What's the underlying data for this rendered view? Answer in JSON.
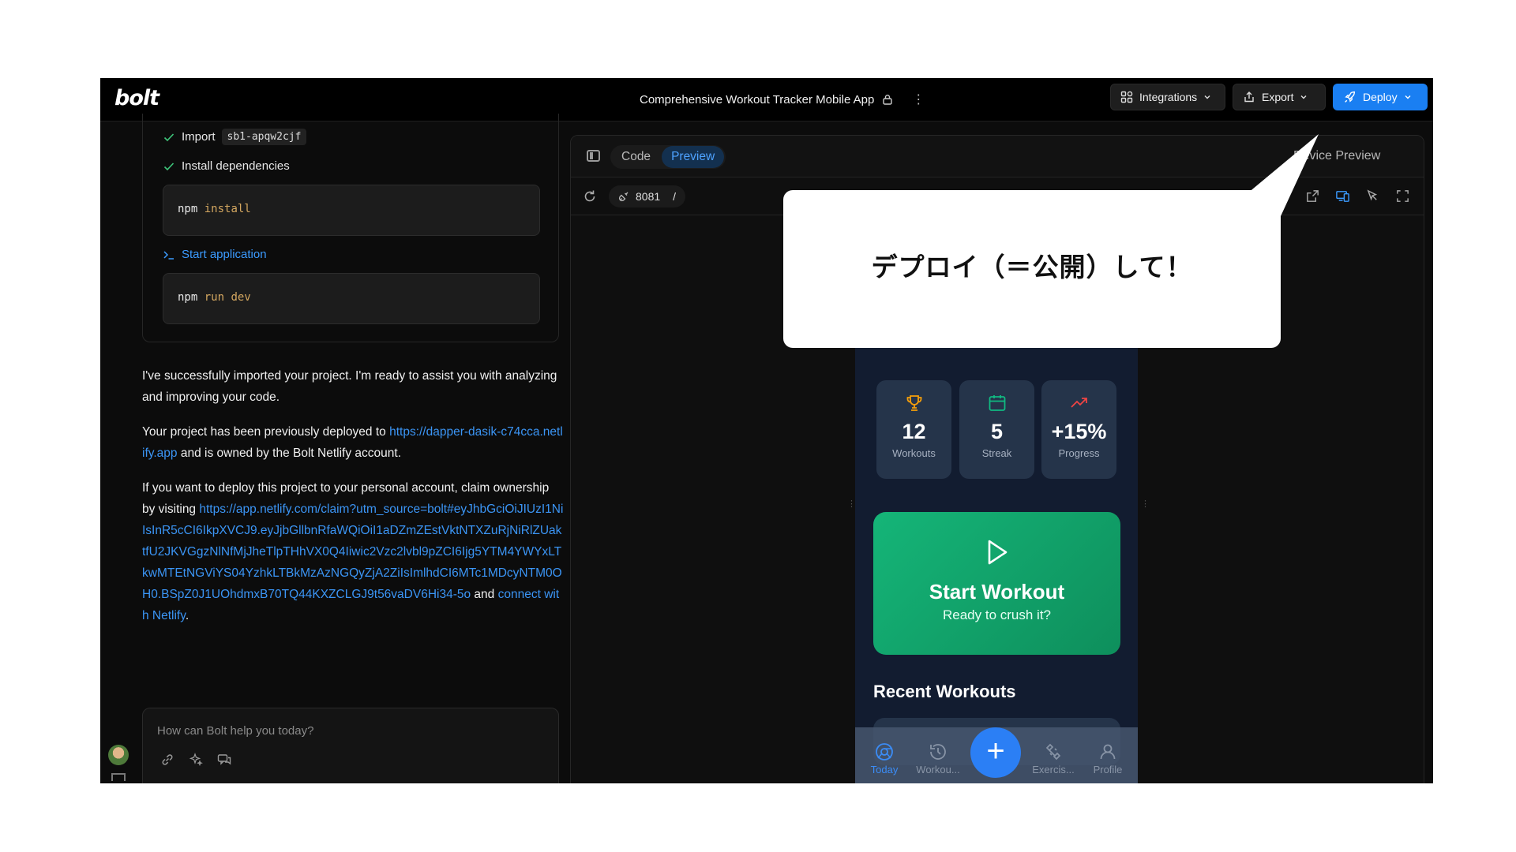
{
  "topbar": {
    "logo": "bolt",
    "project_title": "Comprehensive Workout Tracker Mobile App",
    "kebab": "⋮",
    "integrations_label": "Integrations",
    "export_label": "Export",
    "deploy_label": "Deploy"
  },
  "chat": {
    "steps": [
      {
        "label": "Import",
        "code": "sb1-apqw2cjf",
        "status": "done"
      },
      {
        "label": "Install dependencies",
        "status": "done"
      },
      {
        "label": "Start application",
        "status": "running"
      }
    ],
    "commands": [
      {
        "cmd": "npm",
        "args": "install"
      },
      {
        "cmd": "npm",
        "args": "run dev"
      }
    ],
    "message": {
      "p1": "I've successfully imported your project. I'm ready to assist you with analyzing and improving your code.",
      "p2_before": "Your project has been previously deployed to ",
      "p2_link": "https://dapper-dasik-c74cca.netlify.app",
      "p2_after": " and is owned by the Bolt Netlify account.",
      "p3_before": "If you want to deploy this project to your personal account, claim ownership by visiting ",
      "p3_link": "https://app.netlify.com/claim?utm_source=bolt#eyJhbGciOiJIUzI1NiIsInR5cCI6IkpXVCJ9.eyJjbGllbnRfaWQiOiI1aDZmZEstVktNTXZuRjNiRlZUaktfU2JKVGgzNlNfMjJheTlpTHhVX0Q4Iiwic2Vzc2lvbl9pZCI6Ijg5YTM4YWYxLTkwMTEtNGViYS04YzhkLTBkMzAzNGQyZjA2ZiIsImlhdCI6MTc1MDcyNTM0OH0.BSpZ0J1UOhdmxB70TQ44KXZCLGJ9t56vaDV6Hi34-5o",
      "p3_middle": " and ",
      "p3_link2": "connect with Netlify",
      "p3_after": "."
    },
    "prompt_placeholder": "How can Bolt help you today?"
  },
  "workbench": {
    "tabs": [
      "Code",
      "Preview"
    ],
    "active_tab": "Preview",
    "device_preview_label": "Device Preview",
    "port": "8081",
    "path": "/"
  },
  "phone": {
    "stats": [
      {
        "value": "12",
        "label": "Workouts",
        "icon": "trophy-icon",
        "color": "#f59e0b"
      },
      {
        "value": "5",
        "label": "Streak",
        "icon": "calendar-icon",
        "color": "#10b981"
      },
      {
        "value": "+15%",
        "label": "Progress",
        "icon": "trending-up-icon",
        "color": "#ef4444"
      }
    ],
    "start_title": "Start Workout",
    "start_subtitle": "Ready to crush it?",
    "recent_title": "Recent Workouts",
    "nav": [
      {
        "label": "Today",
        "icon": "today-icon",
        "active": true
      },
      {
        "label": "Workou...",
        "icon": "history-icon",
        "active": false
      },
      {
        "label": "Exercis...",
        "icon": "exercises-icon",
        "active": false
      },
      {
        "label": "Profile",
        "icon": "profile-icon",
        "active": false
      }
    ],
    "fab_label": "+"
  },
  "callout": {
    "text": "デプロイ（＝公開）して！"
  },
  "colors": {
    "accent": "#1a7ff2",
    "link": "#3b95f5",
    "start_card": "#15b578",
    "phone_bg": "#121c30"
  }
}
